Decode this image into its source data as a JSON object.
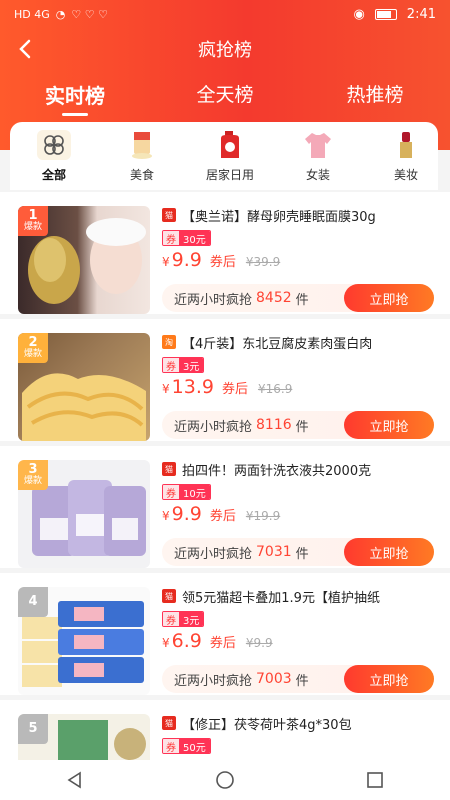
{
  "statusbar": {
    "left": "HD 4G",
    "time": "2:41"
  },
  "nav": {
    "title": "疯抢榜"
  },
  "tabs": [
    {
      "label": "实时榜"
    },
    {
      "label": "全天榜"
    },
    {
      "label": "热推榜"
    }
  ],
  "categories": [
    {
      "label": "全部"
    },
    {
      "label": "美食"
    },
    {
      "label": "居家日用"
    },
    {
      "label": "女装"
    },
    {
      "label": "美妆"
    }
  ],
  "products": [
    {
      "rank": "1",
      "rank_tag": "爆款",
      "rank_color": "#ff5c3a",
      "platform": "天猫",
      "title": "【奥兰诺】酵母卵壳睡眠面膜30g",
      "coupon_label": "券",
      "coupon_value": "30元",
      "currency": "¥",
      "price": "9.9",
      "after_label": "券后",
      "orig_price": "¥39.9",
      "hot_label": "近两小时疯抢",
      "hot_count": "8452",
      "hot_unit": "件",
      "buy_label": "立即抢"
    },
    {
      "rank": "2",
      "rank_tag": "爆款",
      "rank_color": "#ffb13b",
      "platform": "淘宝",
      "title": "【4斤装】东北豆腐皮素肉蛋白肉",
      "coupon_label": "券",
      "coupon_value": "3元",
      "currency": "¥",
      "price": "13.9",
      "after_label": "券后",
      "orig_price": "¥16.9",
      "hot_label": "近两小时疯抢",
      "hot_count": "8116",
      "hot_unit": "件",
      "buy_label": "立即抢"
    },
    {
      "rank": "3",
      "rank_tag": "爆款",
      "rank_color": "#ffb64b",
      "platform": "天猫",
      "title": "拍四件！两面针洗衣液共2000克",
      "coupon_label": "券",
      "coupon_value": "10元",
      "currency": "¥",
      "price": "9.9",
      "after_label": "券后",
      "orig_price": "¥19.9",
      "hot_label": "近两小时疯抢",
      "hot_count": "7031",
      "hot_unit": "件",
      "buy_label": "立即抢"
    },
    {
      "rank": "4",
      "rank_tag": "",
      "rank_color": "#b9b9b9",
      "platform": "天猫",
      "title": "领5元猫超卡叠加1.9元【植护抽纸",
      "coupon_label": "券",
      "coupon_value": "3元",
      "currency": "¥",
      "price": "6.9",
      "after_label": "券后",
      "orig_price": "¥9.9",
      "hot_label": "近两小时疯抢",
      "hot_count": "7003",
      "hot_unit": "件",
      "buy_label": "立即抢"
    },
    {
      "rank": "5",
      "rank_tag": "",
      "rank_color": "#b9b9b9",
      "platform": "天猫",
      "title": "【修正】茯苓荷叶茶4g*30包",
      "coupon_label": "券",
      "coupon_value": "50元",
      "currency": "¥",
      "price": "",
      "after_label": "",
      "orig_price": "",
      "hot_label": "",
      "hot_count": "",
      "hot_unit": "",
      "buy_label": ""
    }
  ],
  "colors": {
    "brand": "#f43a2e",
    "price": "#ff4433"
  }
}
